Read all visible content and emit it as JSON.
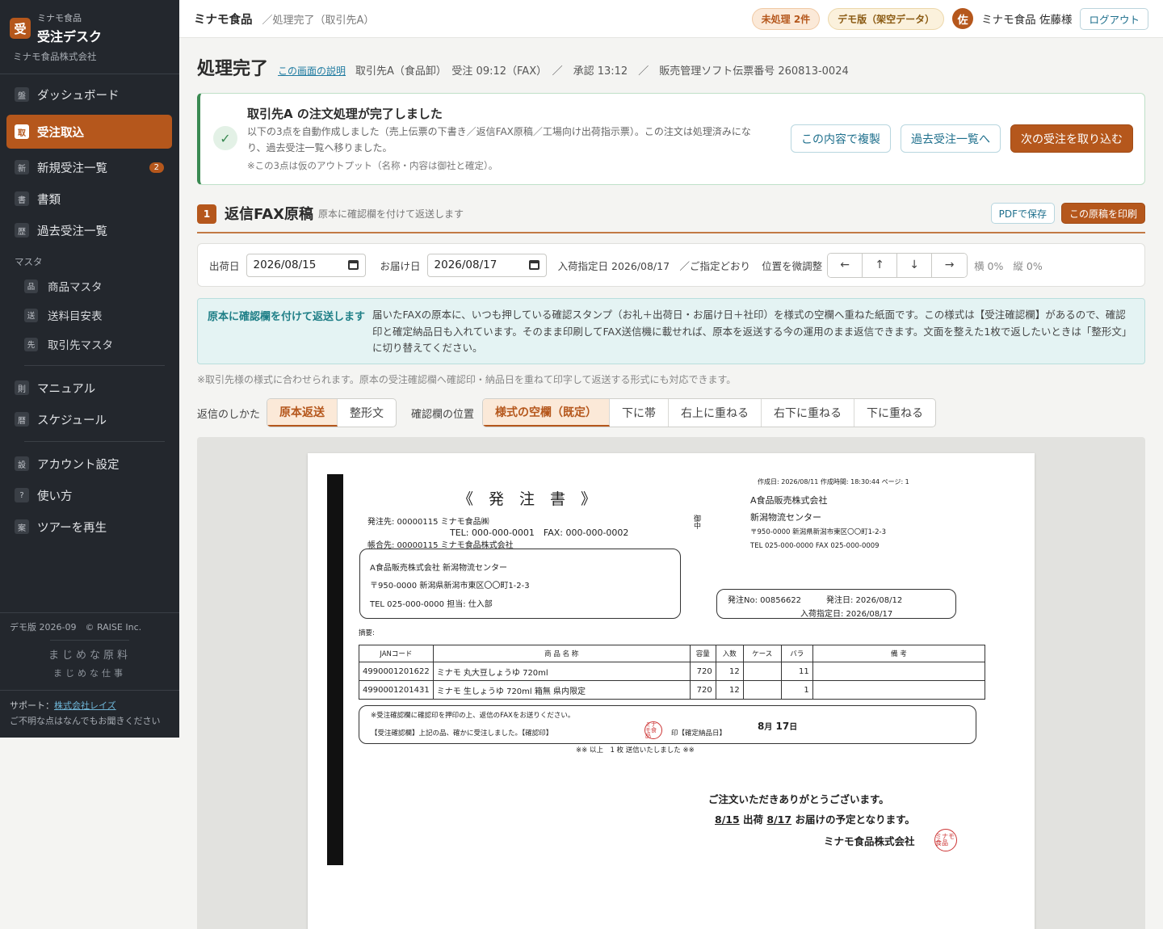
{
  "sidebar": {
    "logo": "受",
    "app_small": "ミナモ食品",
    "app_title": "受注デスク",
    "company": "ミナモ食品株式会社",
    "nav": [
      {
        "icon": "盤",
        "label": "ダッシュボード"
      },
      {
        "icon": "取",
        "label": "受注取込"
      },
      {
        "icon": "新",
        "label": "新規受注一覧",
        "badge": "2"
      },
      {
        "icon": "書",
        "label": "書類"
      },
      {
        "icon": "歴",
        "label": "過去受注一覧"
      }
    ],
    "master_section": "マスタ",
    "masters": [
      {
        "icon": "品",
        "label": "商品マスタ"
      },
      {
        "icon": "送",
        "label": "送料目安表"
      },
      {
        "icon": "先",
        "label": "取引先マスタ"
      }
    ],
    "nav2": [
      {
        "icon": "則",
        "label": "マニュアル"
      },
      {
        "icon": "暦",
        "label": "スケジュール"
      }
    ],
    "nav3": [
      {
        "icon": "設",
        "label": "アカウント設定"
      },
      {
        "icon": "?",
        "label": "使い方"
      },
      {
        "icon": "案",
        "label": "ツアーを再生"
      }
    ],
    "version": "デモ版 2026-09　© RAISE Inc.",
    "slogan1": "まじめな原料",
    "slogan2": "まじめな仕事",
    "support_label": "サポート：",
    "support_link": "株式会社レイズ",
    "support_note": "ご不明な点はなんでもお聞きください"
  },
  "topbar": {
    "company": "ミナモ食品",
    "crumb": "／処理完了（取引先A）",
    "pending": "未処理 2件",
    "demo": "デモ版（架空データ）",
    "avatar": "佐",
    "user": "ミナモ食品 佐藤様",
    "logout": "ログアウト"
  },
  "page": {
    "title": "処理完了",
    "help": "この画面の説明",
    "meta": "取引先A（食品卸）　受注 09:12（FAX）　／　承認 13:12　／　販売管理ソフト伝票番号 260813-0024"
  },
  "alert": {
    "title": "取引先A の注文処理が完了しました",
    "text": "以下の3点を自動作成しました（売上伝票の下書き／返信FAX原稿／工場向け出荷指示票）。この注文は処理済みになり、過去受注一覧へ移りました。",
    "note": "※この3点は仮のアウトプット（名称・内容は御社と確定）。",
    "btn_copy": "この内容で複製",
    "btn_list": "過去受注一覧へ",
    "btn_next": "次の受注を取り込む"
  },
  "section": {
    "num": "1",
    "title": "返信FAX原稿",
    "sub": "原本に確認欄を付けて返送します",
    "btn_pdf": "PDFで保存",
    "btn_print": "この原稿を印刷"
  },
  "controls": {
    "ship_label": "出荷日",
    "ship_value": "2026/08/15",
    "deliver_label": "お届け日",
    "deliver_value": "2026/08/17",
    "arrival": "入荷指定日 2026/08/17　／ご指定どおり",
    "adjust_label": "位置を微調整",
    "arrows": [
      "←",
      "↑",
      "↓",
      "→"
    ],
    "h_offset": "横 0%",
    "v_offset": "縦 0%"
  },
  "info": {
    "label": "原本に確認欄を付けて返送します",
    "text": "届いたFAXの原本に、いつも押している確認スタンプ（お礼＋出荷日・お届け日＋社印）を様式の空欄へ重ねた紙面です。この様式は【受注確認欄】があるので、確認印と確定納品日も入れています。そのまま印刷してFAX送信機に載せれば、原本を返送する今の運用のまま返信できます。文面を整えた1枚で返したいときは「整形文」に切り替えてください。"
  },
  "footnote": "※取引先様の様式に合わせられます。原本の受注確認欄へ確認印・納品日を重ねて印字して返送する形式にも対応できます。",
  "toggles": {
    "reply_label": "返信のしかた",
    "reply_options": [
      "原本返送",
      "整形文"
    ],
    "pos_label": "確認欄の位置",
    "pos_options": [
      "様式の空欄（既定）",
      "下に帯",
      "右上に重ねる",
      "右下に重ねる",
      "下に重ねる"
    ]
  },
  "fax": {
    "created": "作成日: 2026/08/11 作成時間: 18:30:44 ページ: 1",
    "title": "《　発　注　書　》",
    "to_line": "発注先: 00000115 ミナモ食品㈱",
    "tel_line": "TEL: 000-000-0001　FAX: 000-000-0002",
    "acct_line": "帳合先: 00000115 ミナモ食品株式会社",
    "onchu": "御中",
    "sender_name": "A食品販売株式会社",
    "sender_center": "新潟物流センター",
    "sender_addr": "〒950-0000 新潟県新潟市東区〇〇町1-2-3",
    "sender_tel": "TEL 025-000-0000 FAX 025-000-0009",
    "box1_line1": "A食品販売株式会社 新潟物流センター",
    "box1_line2": "〒950-0000 新潟県新潟市東区〇〇町1-2-3",
    "box1_line3": "TEL 025-000-0000 担当: 仕入部",
    "order_no": "発注No: 00856622",
    "order_date": "発注日: 2026/08/12",
    "arrival_date": "入荷指定日: 2026/08/17",
    "memo": "摘要:",
    "headers": [
      "JANコード",
      "商 品 名 称",
      "容量",
      "入数",
      "ケース",
      "バラ",
      "備 考"
    ],
    "rows": [
      {
        "jan": "4990001201622",
        "name": "ミナモ 丸大豆しょうゆ 720ml",
        "vol": "720",
        "qty": "12",
        "case": "",
        "bara": "11",
        "note": ""
      },
      {
        "jan": "4990001201431",
        "name": "ミナモ 生しょうゆ 720ml 箱無 県内限定",
        "vol": "720",
        "qty": "12",
        "case": "",
        "bara": "1",
        "note": ""
      }
    ],
    "confirm_note": "※受注確認欄に確認印を押印の上、返信のFAXをお送りください。",
    "confirm_line": "【受注確認欄】上記の品、確かに受注しました。【確認印】",
    "stamp_text": "ミナモ食品",
    "seal_label": "印【確定納品日】",
    "month": "8",
    "month_unit": "月",
    "day": "17",
    "day_unit": "日",
    "sent_line": "※※ 以上　1 枚 送信いたしました ※※",
    "thanks": "ご注文いただきありがとうございます。",
    "ship_short": "8/15",
    "ship_word": "出荷",
    "deliver_short": "8/17",
    "deliver_word": "お届けの予定となります。",
    "company_sign": "ミナモ食品株式会社"
  },
  "colors": {
    "accent": "#b5571c",
    "sidebar": "#23272d",
    "success": "#3a8a52",
    "info_bg": "#e4f3f3"
  }
}
